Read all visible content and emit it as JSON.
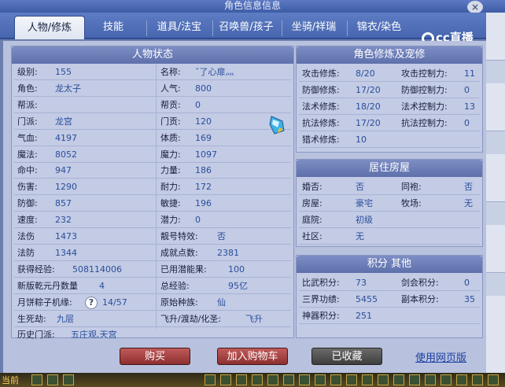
{
  "window": {
    "title": "角色信息信息",
    "close_label": "×"
  },
  "tabs": [
    {
      "label": "人物/修炼",
      "active": true
    },
    {
      "label": "技能"
    },
    {
      "label": "道具/法宝"
    },
    {
      "label": "召唤兽/孩子"
    },
    {
      "label": "坐骑/祥瑞"
    },
    {
      "label": "锦衣/染色"
    }
  ],
  "logo": {
    "text": "cc直播"
  },
  "status": {
    "heading": "人物状态",
    "left": [
      {
        "label": "级别:",
        "value": "155"
      },
      {
        "label": "角色:",
        "value": "龙太子"
      },
      {
        "label": "帮派:",
        "value": ""
      },
      {
        "label": "门派:",
        "value": "龙宫"
      },
      {
        "label": "气血:",
        "value": "4197"
      },
      {
        "label": "魔法:",
        "value": "8052"
      },
      {
        "label": "命中:",
        "value": "947"
      },
      {
        "label": "伤害:",
        "value": "1290"
      },
      {
        "label": "防御:",
        "value": "857"
      },
      {
        "label": "速度:",
        "value": "232"
      },
      {
        "label": "法伤",
        "value": "1473"
      },
      {
        "label": "法防",
        "value": "1344"
      },
      {
        "label": "获得经验:",
        "value": "508114006"
      },
      {
        "label": "新版乾元丹数量",
        "value": "4"
      },
      {
        "label": "月饼粽子机缘:",
        "value": "14/57"
      },
      {
        "label": "生死劫:",
        "value": "九层"
      },
      {
        "label": "历史门派:",
        "value": "五庄观,天宫"
      }
    ],
    "right": [
      {
        "label": "名称:",
        "value": "ˇ了心扉灬"
      },
      {
        "label": "人气:",
        "value": "800"
      },
      {
        "label": "帮贡:",
        "value": "0"
      },
      {
        "label": "门贡:",
        "value": "120"
      },
      {
        "label": "体质:",
        "value": "169"
      },
      {
        "label": "魔力:",
        "value": "1097"
      },
      {
        "label": "力量:",
        "value": "186"
      },
      {
        "label": "耐力:",
        "value": "172"
      },
      {
        "label": "敏捷:",
        "value": "196"
      },
      {
        "label": "潜力:",
        "value": "0"
      },
      {
        "label": "靓号特效:",
        "value": "否"
      },
      {
        "label": "成就点数:",
        "value": "2381"
      },
      {
        "label": "已用潜能果:",
        "value": "100"
      },
      {
        "label": "总经验:",
        "value": "95亿"
      },
      {
        "label": "原始种族:",
        "value": "仙"
      },
      {
        "label": "飞升/渡劫/化圣:",
        "value": "飞升"
      }
    ],
    "help_label": "?"
  },
  "cultivation": {
    "heading": "角色修炼及宠修",
    "rows": [
      {
        "l1": "攻击修炼:",
        "v1": "8/20",
        "l2": "攻击控制力:",
        "v2": "11"
      },
      {
        "l1": "防御修炼:",
        "v1": "17/20",
        "l2": "防御控制力:",
        "v2": "0"
      },
      {
        "l1": "法术修炼:",
        "v1": "18/20",
        "l2": "法术控制力:",
        "v2": "13"
      },
      {
        "l1": "抗法修炼:",
        "v1": "17/20",
        "l2": "抗法控制力:",
        "v2": "0"
      },
      {
        "l1": "猎术修炼:",
        "v1": "10",
        "l2": "",
        "v2": ""
      }
    ]
  },
  "house": {
    "heading": "居住房屋",
    "rows": [
      {
        "l1": "婚否:",
        "v1": "否",
        "l2": "同袍:",
        "v2": "否"
      },
      {
        "l1": "房屋:",
        "v1": "豪宅",
        "l2": "牧场:",
        "v2": "无"
      },
      {
        "l1": "庭院:",
        "v1": "初级",
        "l2": "",
        "v2": ""
      },
      {
        "l1": "社区:",
        "v1": "无",
        "l2": "",
        "v2": ""
      }
    ]
  },
  "score": {
    "heading": "积分 其他",
    "rows": [
      {
        "l1": "比武积分:",
        "v1": "73",
        "l2": "剑会积分:",
        "v2": "0"
      },
      {
        "l1": "三界功绩:",
        "v1": "5455",
        "l2": "副本积分:",
        "v2": "35"
      },
      {
        "l1": "神器积分:",
        "v1": "251",
        "l2": "",
        "v2": ""
      }
    ]
  },
  "footer": {
    "buy": "购买",
    "add_cart": "加入购物车",
    "collected": "已收藏",
    "web_version": "使用网页版"
  },
  "bottombar": {
    "badge": "当前"
  },
  "colors": {
    "tab_bar": "#4766af",
    "panel_head": "#6f80bb",
    "panel_bg": "#c3cbe5",
    "value_text": "#2a4e9a",
    "buy_button": "#a84545",
    "collected_button": "#555555"
  }
}
